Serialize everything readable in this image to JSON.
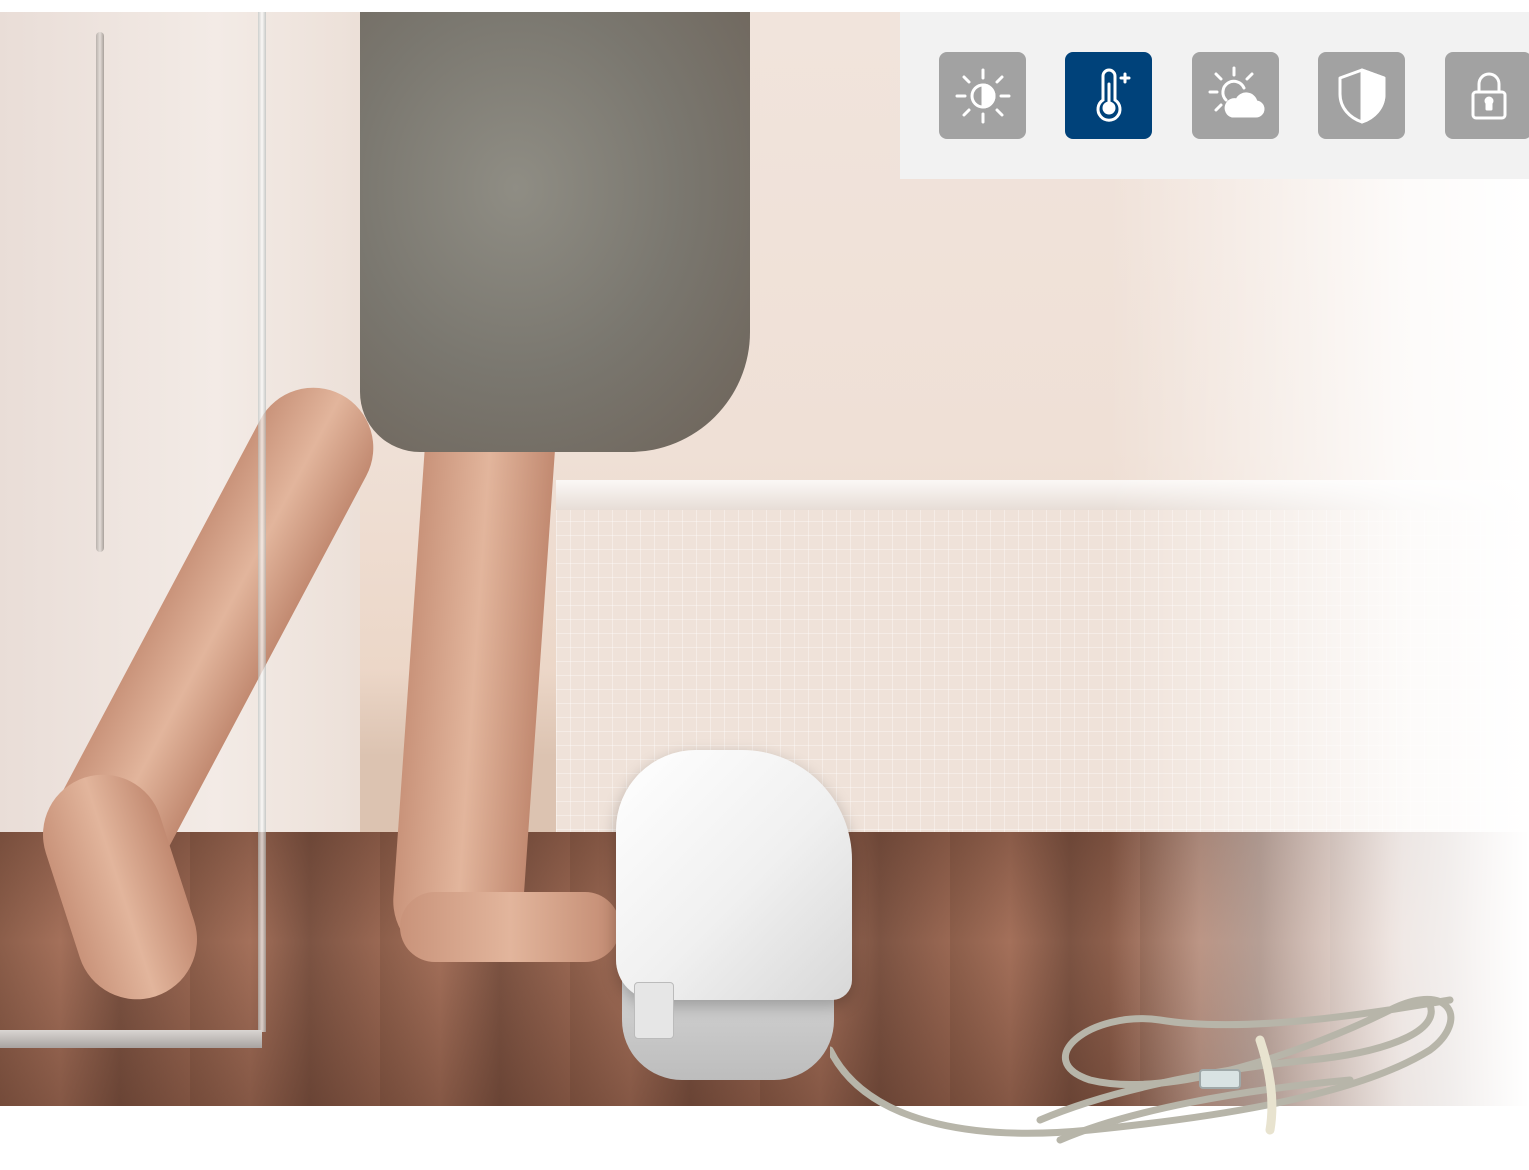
{
  "icons": [
    {
      "name": "brightness-contrast-icon",
      "active": false
    },
    {
      "name": "thermometer-plus-icon",
      "active": true
    },
    {
      "name": "weather-sun-cloud-icon",
      "active": false
    },
    {
      "name": "shield-icon",
      "active": false
    },
    {
      "name": "padlock-icon",
      "active": false
    }
  ],
  "colors": {
    "tile_inactive": "#a2a2a2",
    "tile_active": "#00427a",
    "panel": "#f2f2f2"
  }
}
